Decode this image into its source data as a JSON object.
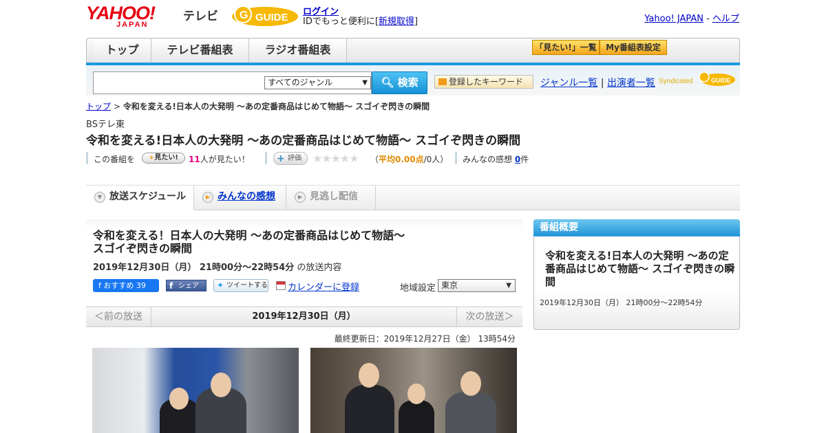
{
  "header": {
    "yahoo_logo": "YAHOO!",
    "japan_text": "JAPAN",
    "tv_text": "テレビ",
    "gguide_logo": "G-GUIDE",
    "login": "ログイン",
    "login_msg_pre": "IDでもっと便利に[",
    "signup": "新規取得",
    "login_msg_post": "]",
    "yahoo_japan_link": "Yahoo! JAPAN",
    "separator": " - ",
    "help_link": "ヘルプ"
  },
  "nav": {
    "tabs": [
      "トップ",
      "テレビ番組表",
      "ラジオ番組表"
    ],
    "mitai_list": "「見たい!」一覧",
    "my_schedule": "My番組表設定"
  },
  "search": {
    "genre_selected": "すべてのジャンル",
    "search_button": "検索",
    "keyword_button": "登録したキーワード",
    "genre_list": "ジャンル一覧",
    "divider": "|",
    "performer_list": "出演者一覧",
    "syndicated": "Syndicated"
  },
  "breadcrumb": {
    "top": "トップ",
    "sep": " > ",
    "current": "令和を変える!日本人の大発明 ～あの定番商品はじめて物語～ スゴイぞ閃きの瞬間"
  },
  "program": {
    "station": "BSテレ東",
    "title": "令和を変える!日本人の大発明 ～あの定番商品はじめて物語～ スゴイぞ閃きの瞬間"
  },
  "rating": {
    "pre": "この番組を",
    "mitai_btn": "見たい!",
    "count": "11",
    "count_suffix": "人が見たい！",
    "hyoka_btn": "評価",
    "stars": "★★★★★",
    "avg_open": "（",
    "avg_label": "平均0.00点",
    "avg_people": "/0人）",
    "review_label": "みんなの感想",
    "review_count": "0",
    "review_suffix": "件"
  },
  "tabs": {
    "schedule": "放送スケジュール",
    "reviews": "みんなの感想",
    "missed": "見逃し配信"
  },
  "main": {
    "title_line1": "令和を変える！日本人の大発明 ～あの定番商品はじめて物語～",
    "title_line2": "スゴイぞ閃きの瞬間",
    "date": "2019年12月30日（月）  21時00分～22時54分",
    "date_suffix": "の放送内容",
    "fb_recommend": "おすすめ",
    "fb_count": "39",
    "share": "シェア",
    "tweet": "ツイートする",
    "calendar": "カレンダーに登録",
    "region_label": "地域設定",
    "region_value": "東京",
    "prev": "＜前の放送",
    "current_date": "2019年12月30日（月）",
    "next": "次の放送＞",
    "updated": "最終更新日：2019年12月27日（金） 13時54分"
  },
  "sidebar": {
    "heading": "番組概要",
    "title": "令和を変える!日本人の大発明 ～あの定番商品はじめて物語～ スゴイぞ閃きの瞬間",
    "date": "2019年12月30日（月） 21時00分～22時54分"
  },
  "colors": {
    "accent_blue": "#1a9ae0",
    "yahoo_red": "#e60012",
    "count_pink": "#e4007f",
    "avg_orange": "#e08a00"
  }
}
